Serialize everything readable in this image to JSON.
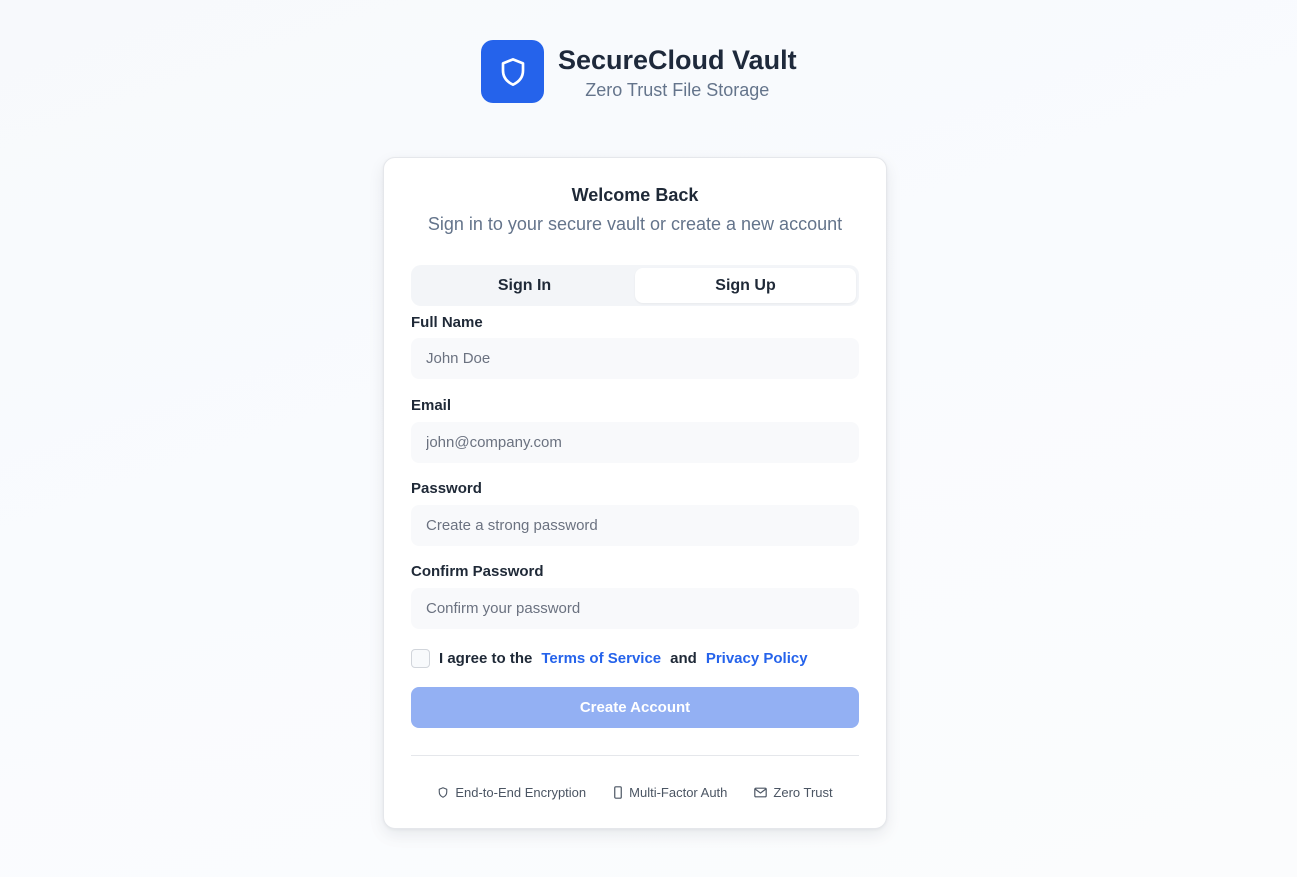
{
  "brand": {
    "title": "SecureCloud Vault",
    "subtitle": "Zero Trust File Storage",
    "logo_icon": "shield-icon",
    "accent_color": "#2563eb"
  },
  "card": {
    "title": "Welcome Back",
    "subtitle": "Sign in to your secure vault or create a new account"
  },
  "tabs": [
    {
      "label": "Sign In",
      "active": false
    },
    {
      "label": "Sign Up",
      "active": true
    }
  ],
  "form": {
    "full_name": {
      "label": "Full Name",
      "placeholder": "John Doe",
      "value": ""
    },
    "email": {
      "label": "Email",
      "placeholder": "john@company.com",
      "value": ""
    },
    "password": {
      "label": "Password",
      "placeholder": "Create a strong password",
      "value": ""
    },
    "confirm_password": {
      "label": "Confirm Password",
      "placeholder": "Confirm your password",
      "value": ""
    },
    "agree": {
      "checked": false,
      "prefix": "I agree to the",
      "terms_link": "Terms of Service",
      "conjunction": "and",
      "privacy_link": "Privacy Policy"
    },
    "submit_label": "Create Account",
    "submit_color": "#93b0f3"
  },
  "features": [
    {
      "label": "End-to-End Encryption",
      "icon": "shield-icon"
    },
    {
      "label": "Multi-Factor Auth",
      "icon": "smartphone-icon"
    },
    {
      "label": "Zero Trust",
      "icon": "mail-icon"
    }
  ]
}
